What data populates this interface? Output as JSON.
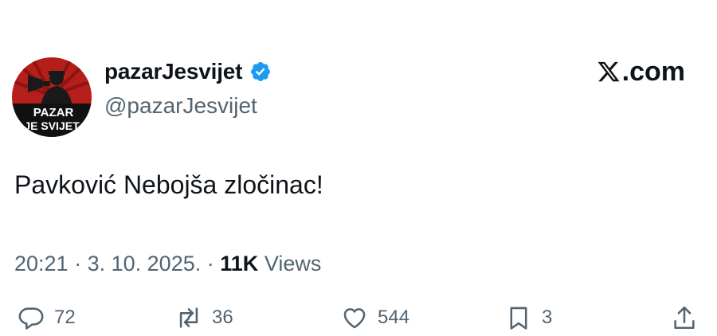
{
  "author": {
    "display_name": "pazarJesvijet",
    "handle": "@pazarJesvijet",
    "avatar_text_line1": "PAZAR",
    "avatar_text_line2": "JE SVIJET",
    "verified": true
  },
  "brand": {
    "text": ".com",
    "logo_icon": "x-logo-icon"
  },
  "tweet": {
    "text": "Pavković Nebojša zločinac!",
    "time": "20:21",
    "separator": "·",
    "date": "3. 10. 2025.",
    "views_count": "11K",
    "views_label": "Views"
  },
  "actions": {
    "replies": "72",
    "reposts": "36",
    "likes": "544",
    "bookmarks": "3"
  },
  "colors": {
    "text": "#0f1419",
    "secondary": "#536471",
    "verified": "#1d9bf0",
    "avatar_red": "#b51f1b"
  }
}
